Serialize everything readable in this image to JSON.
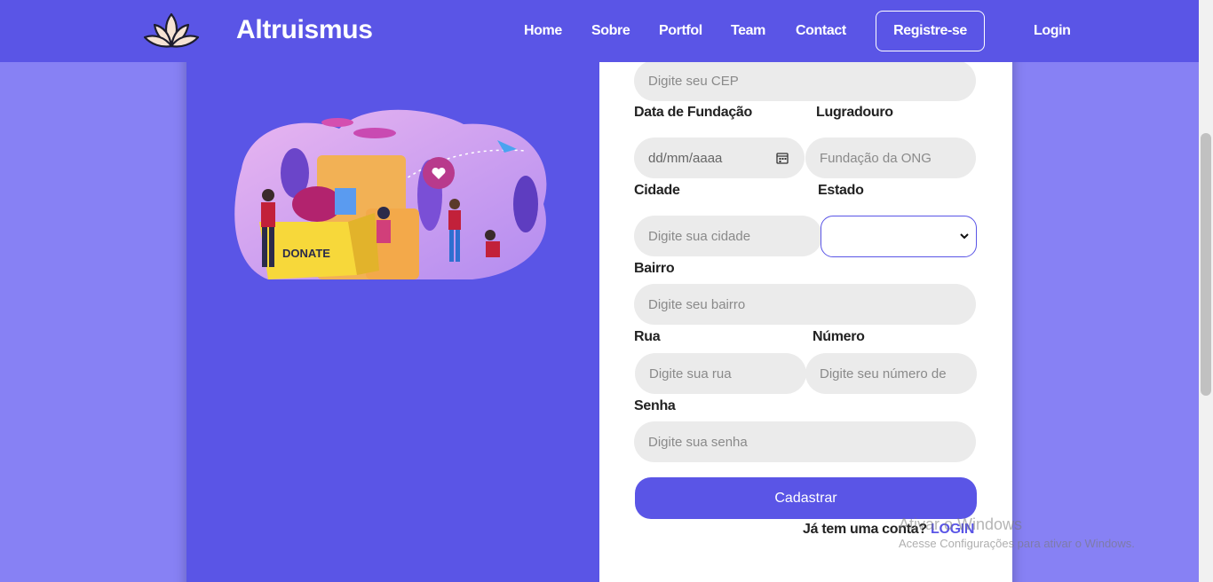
{
  "navbar": {
    "brand": "Altruismus",
    "links": [
      "Home",
      "Sobre",
      "Portfol",
      "Team",
      "Contact"
    ],
    "register": "Registre-se",
    "login": "Login"
  },
  "illustration": {
    "box_text": "DONATE"
  },
  "form": {
    "cep_placeholder": "Digite seu CEP",
    "fundacao_label": "Data de Fundação",
    "fundacao_placeholder": "dd/mm/aaaa",
    "logradouro_label": "Lugradouro",
    "logradouro_placeholder": "Fundação da ONG",
    "cidade_label": "Cidade",
    "cidade_placeholder": "Digite sua cidade",
    "estado_label": "Estado",
    "estado_value": "",
    "bairro_label": "Bairro",
    "bairro_placeholder": "Digite seu bairro",
    "rua_label": "Rua",
    "rua_placeholder": "Digite sua rua",
    "numero_label": "Número",
    "numero_placeholder": "Digite seu número de",
    "senha_label": "Senha",
    "senha_placeholder": "Digite sua senha",
    "submit": "Cadastrar",
    "account_question": "Já tem uma conta?",
    "account_login": "LOGIN"
  },
  "watermark": {
    "title": "Ativar o Windows",
    "subtitle": "Acesse Configurações para ativar o Windows."
  },
  "colors": {
    "primary": "#5a55e6",
    "background": "#8781f4",
    "input": "#ebebeb"
  }
}
